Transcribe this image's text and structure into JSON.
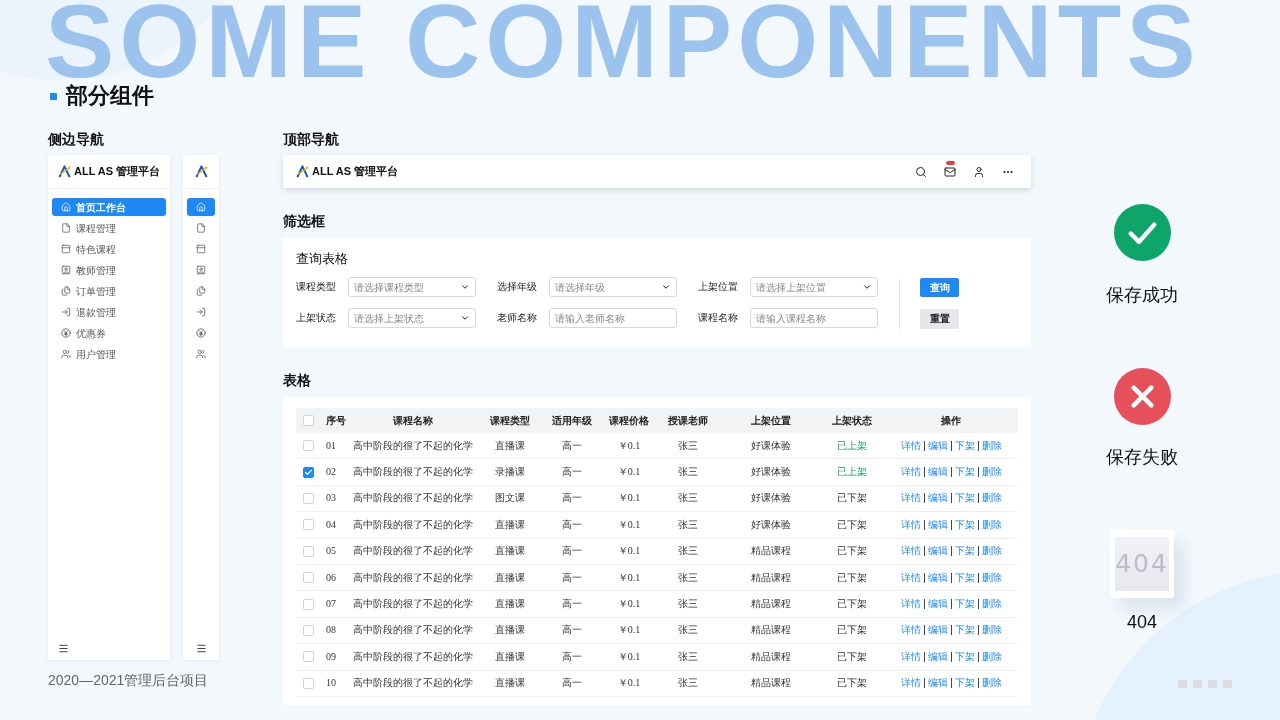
{
  "backdrop_title": "SOME COMPONENTS",
  "page_title": "部分组件",
  "side_nav": {
    "label": "侧边导航",
    "expanded": {
      "brand": "ALL AS 管理平台",
      "items": [
        {
          "label": "首页工作台",
          "selected": true
        },
        {
          "label": "课程管理",
          "selected": false
        },
        {
          "label": "特色课程",
          "selected": false
        },
        {
          "label": "教师管理",
          "selected": false
        },
        {
          "label": "订单管理",
          "selected": false
        },
        {
          "label": "退款管理",
          "selected": false
        },
        {
          "label": "优惠券",
          "selected": false
        },
        {
          "label": "用户管理",
          "selected": false
        }
      ]
    },
    "collapsed": {
      "items": [
        {
          "selected": true
        },
        {
          "selected": false
        },
        {
          "selected": false
        },
        {
          "selected": false
        },
        {
          "selected": false
        },
        {
          "selected": false
        },
        {
          "selected": false
        },
        {
          "selected": false
        }
      ]
    }
  },
  "footer_note": "2020—2021管理后台项目",
  "top_nav": {
    "label": "顶部导航",
    "brand": "ALL AS 管理平台",
    "mail_badge": true
  },
  "filter": {
    "label": "筛选框",
    "title": "查询表格",
    "fields": [
      {
        "label": "课程类型",
        "kind": "select",
        "placeholder": "请选择课程类型"
      },
      {
        "label": "选择年级",
        "kind": "select",
        "placeholder": "请选择年级"
      },
      {
        "label": "上架位置",
        "kind": "select",
        "placeholder": "请选择上架位置"
      },
      {
        "label": "上架状态",
        "kind": "select",
        "placeholder": "请选择上架状态"
      },
      {
        "label": "老师名称",
        "kind": "input",
        "placeholder": "请输入老师名称"
      },
      {
        "label": "课程名称",
        "kind": "input",
        "placeholder": "请输入课程名称"
      }
    ],
    "buttons": [
      {
        "label": "查询",
        "kind": "primary"
      },
      {
        "label": "重置",
        "kind": "secondary"
      }
    ]
  },
  "table_section": {
    "label": "表格",
    "select_all_checked": false,
    "columns": [
      "序号",
      "课程名称",
      "课程类型",
      "适用年级",
      "课程价格",
      "授课老师",
      "上架位置",
      "上架状态",
      "操作"
    ],
    "rows": [
      {
        "selected": false,
        "number": "01",
        "course": "高中阶段的很了不起的化学",
        "type": "直播课",
        "grade": "高一",
        "price": "￥0.1",
        "teacher": "张三",
        "position": "好课体验",
        "status": "已上架",
        "on_shelf": true,
        "actions": [
          "详情",
          "编辑",
          "下架",
          "删除"
        ]
      },
      {
        "selected": true,
        "number": "02",
        "course": "高中阶段的很了不起的化学",
        "type": "录播课",
        "grade": "高一",
        "price": "￥0.1",
        "teacher": "张三",
        "position": "好课体验",
        "status": "已上架",
        "on_shelf": true,
        "actions": [
          "详情",
          "编辑",
          "下架",
          "删除"
        ]
      },
      {
        "selected": false,
        "number": "03",
        "course": "高中阶段的很了不起的化学",
        "type": "图文课",
        "grade": "高一",
        "price": "￥0.1",
        "teacher": "张三",
        "position": "好课体验",
        "status": "已下架",
        "on_shelf": false,
        "actions": [
          "详情",
          "编辑",
          "下架",
          "删除"
        ]
      },
      {
        "selected": false,
        "number": "04",
        "course": "高中阶段的很了不起的化学",
        "type": "直播课",
        "grade": "高一",
        "price": "￥0.1",
        "teacher": "张三",
        "position": "好课体验",
        "status": "已下架",
        "on_shelf": false,
        "actions": [
          "详情",
          "编辑",
          "下架",
          "删除"
        ]
      },
      {
        "selected": false,
        "number": "05",
        "course": "高中阶段的很了不起的化学",
        "type": "直播课",
        "grade": "高一",
        "price": "￥0.1",
        "teacher": "张三",
        "position": "精品课程",
        "status": "已下架",
        "on_shelf": false,
        "actions": [
          "详情",
          "编辑",
          "下架",
          "删除"
        ]
      },
      {
        "selected": false,
        "number": "06",
        "course": "高中阶段的很了不起的化学",
        "type": "直播课",
        "grade": "高一",
        "price": "￥0.1",
        "teacher": "张三",
        "position": "精品课程",
        "status": "已下架",
        "on_shelf": false,
        "actions": [
          "详情",
          "编辑",
          "下架",
          "删除"
        ]
      },
      {
        "selected": false,
        "number": "07",
        "course": "高中阶段的很了不起的化学",
        "type": "直播课",
        "grade": "高一",
        "price": "￥0.1",
        "teacher": "张三",
        "position": "精品课程",
        "status": "已下架",
        "on_shelf": false,
        "actions": [
          "详情",
          "编辑",
          "下架",
          "删除"
        ]
      },
      {
        "selected": false,
        "number": "08",
        "course": "高中阶段的很了不起的化学",
        "type": "直播课",
        "grade": "高一",
        "price": "￥0.1",
        "teacher": "张三",
        "position": "精品课程",
        "status": "已下架",
        "on_shelf": false,
        "actions": [
          "详情",
          "编辑",
          "下架",
          "删除"
        ]
      },
      {
        "selected": false,
        "number": "09",
        "course": "高中阶段的很了不起的化学",
        "type": "直播课",
        "grade": "高一",
        "price": "￥0.1",
        "teacher": "张三",
        "position": "精品课程",
        "status": "已下架",
        "on_shelf": false,
        "actions": [
          "详情",
          "编辑",
          "下架",
          "删除"
        ]
      },
      {
        "selected": false,
        "number": "10",
        "course": "高中阶段的很了不起的化学",
        "type": "直播课",
        "grade": "高一",
        "price": "￥0.1",
        "teacher": "张三",
        "position": "精品课程",
        "status": "已下架",
        "on_shelf": false,
        "actions": [
          "详情",
          "编辑",
          "下架",
          "删除"
        ]
      }
    ]
  },
  "feedback": [
    {
      "kind": "success",
      "label": "保存成功"
    },
    {
      "kind": "error",
      "label": "保存失败"
    },
    {
      "kind": "not_found",
      "label": "404",
      "illustration_text": "404"
    }
  ]
}
